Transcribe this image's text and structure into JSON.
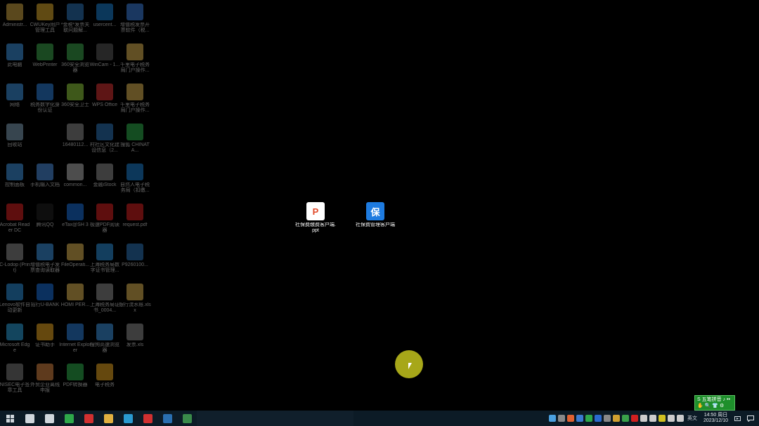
{
  "desktop": {
    "left_icons_dim": [
      {
        "label": "Administr...",
        "color": "#c8a040"
      },
      {
        "label": "CWUKey用户管理工具",
        "color": "#d6a52a"
      },
      {
        "label": "*金税*发票关联问题解...",
        "color": "#2a6fb0"
      },
      {
        "label": "usercent...",
        "color": "#1a7ac8"
      },
      {
        "label": "增值税发票开票软件（税...",
        "color": "#3a7bd5"
      },
      {
        "label": "此电脑",
        "color": "#3b8fd8"
      },
      {
        "label": "WebPrinter",
        "color": "#3aa04a"
      },
      {
        "label": "360安全浏览器",
        "color": "#3aa04a"
      },
      {
        "label": "WinCam - 1...",
        "color": "#555555"
      },
      {
        "label": "千里电子税务局门户操作...",
        "color": "#d8b050"
      },
      {
        "label": "网络",
        "color": "#3b8fd8"
      },
      {
        "label": "税务数字化身份认证",
        "color": "#2a7ad0"
      },
      {
        "label": "360安全卫士",
        "color": "#8ac43a"
      },
      {
        "label": "WPS Office",
        "color": "#d03030"
      },
      {
        "label": "千里电子税务局门户操作...",
        "color": "#d8b050"
      },
      {
        "label": "回收站",
        "color": "#7a9ab0"
      },
      {
        "label": "",
        "color": "#000000"
      },
      {
        "label": "16480112...",
        "color": "#888888"
      },
      {
        "label": "村社区文化建设信息（2...",
        "color": "#2a6fb0"
      },
      {
        "label": "搜狐 CHINATA...",
        "color": "#2ea84a"
      },
      {
        "label": "控制面板",
        "color": "#3b8fd8"
      },
      {
        "label": "手机输入文档",
        "color": "#4a8ad8"
      },
      {
        "label": "common...",
        "color": "#aaaaaa"
      },
      {
        "label": "金融iStock",
        "color": "#888888"
      },
      {
        "label": "自然人电子税务局（扣缴...",
        "color": "#1a7ac8"
      },
      {
        "label": "Acrobat Reader DC",
        "color": "#d02020"
      },
      {
        "label": "腾讯QQ",
        "color": "#202020"
      },
      {
        "label": "eTax@SH 3",
        "color": "#1a6ad0"
      },
      {
        "label": "极速PDF阅读器",
        "color": "#d02020"
      },
      {
        "label": "request.pdf",
        "color": "#d02020"
      },
      {
        "label": "C-Lodop (Print)",
        "color": "#888888"
      },
      {
        "label": "增值税电子发票查询读取器",
        "color": "#3b8fd8"
      },
      {
        "label": "FileOperati...",
        "color": "#d8b050"
      },
      {
        "label": "上海税务局数字证书管理...",
        "color": "#2a8ad0"
      },
      {
        "label": "P9260100...",
        "color": "#2a6fb0"
      },
      {
        "label": "Lenovo软件自动更新",
        "color": "#2a8ad0"
      },
      {
        "label": "招行U-BANK",
        "color": "#1a6ad0"
      },
      {
        "label": "HOMI PER...",
        "color": "#d8b050"
      },
      {
        "label": "上海税务局证书_0004...",
        "color": "#888888"
      },
      {
        "label": "银行流水账.xlsx",
        "color": "#d8b050"
      },
      {
        "label": "Microsoft Edge",
        "color": "#2a9ad0"
      },
      {
        "label": "证书助手",
        "color": "#e0a020"
      },
      {
        "label": "Internet Explorer",
        "color": "#2a7ad0"
      },
      {
        "label": "搜狗高速浏览器",
        "color": "#3b8fd8"
      },
      {
        "label": "发票.xls",
        "color": "#888888"
      },
      {
        "label": "NISEC电子签章工具",
        "color": "#777777"
      },
      {
        "label": "外贸企业离线申报",
        "color": "#d08040"
      },
      {
        "label": "PDF转换器",
        "color": "#2ea84a"
      },
      {
        "label": "电子税务",
        "color": "#e0a020"
      }
    ],
    "center_icons": [
      {
        "label": "社保费缴费客户端.ppt",
        "color": "#e24a2a",
        "glyph": "P"
      },
      {
        "label": "社保费管理客户端",
        "color": "#1e7be0",
        "glyph": "保"
      }
    ]
  },
  "ime": {
    "line1": "S 五笔拼音 ♪ ••",
    "line2": "✋ 🔍 👕 ⚙"
  },
  "taskbar": {
    "start_icon": "windows-start-icon",
    "apps": [
      {
        "name": "task-view-icon",
        "color": "#cfd6dc"
      },
      {
        "name": "search-icon",
        "color": "#cfd6dc"
      },
      {
        "name": "wechat-icon",
        "color": "#2ea84a"
      },
      {
        "name": "wps-icon",
        "color": "#d03030"
      },
      {
        "name": "file-explorer-icon",
        "color": "#e0b040"
      },
      {
        "name": "edge-icon",
        "color": "#2a9ad0"
      },
      {
        "name": "wps-office-icon",
        "color": "#d03030"
      },
      {
        "name": "remote-icon",
        "color": "#2a6fb0"
      },
      {
        "name": "app-icon",
        "color": "#3a8a4a"
      }
    ],
    "tray_icons": [
      {
        "name": "onedrive-icon",
        "color": "#4aa0e0"
      },
      {
        "name": "tray-app-icon",
        "color": "#888888"
      },
      {
        "name": "tray-app-icon",
        "color": "#e06030"
      },
      {
        "name": "tray-app-icon",
        "color": "#3a7ad0"
      },
      {
        "name": "wechat-tray-icon",
        "color": "#2ea84a"
      },
      {
        "name": "tray-app-icon",
        "color": "#2a6ad0"
      },
      {
        "name": "tray-app-icon",
        "color": "#888888"
      },
      {
        "name": "tray-app-icon",
        "color": "#d0a030"
      },
      {
        "name": "security-icon",
        "color": "#3aa04a"
      },
      {
        "name": "tray-app-icon",
        "color": "#d02020"
      },
      {
        "name": "tray-app-icon",
        "color": "#cccccc"
      },
      {
        "name": "usb-icon",
        "color": "#cccccc"
      },
      {
        "name": "tray-app-icon",
        "color": "#d0c020"
      },
      {
        "name": "network-icon",
        "color": "#cccccc"
      },
      {
        "name": "volume-icon",
        "color": "#cccccc"
      }
    ],
    "tray_text": "英文",
    "clock_time": "14:50 周日",
    "clock_date": "2023/12/10",
    "notification_icon": "notification-icon"
  }
}
